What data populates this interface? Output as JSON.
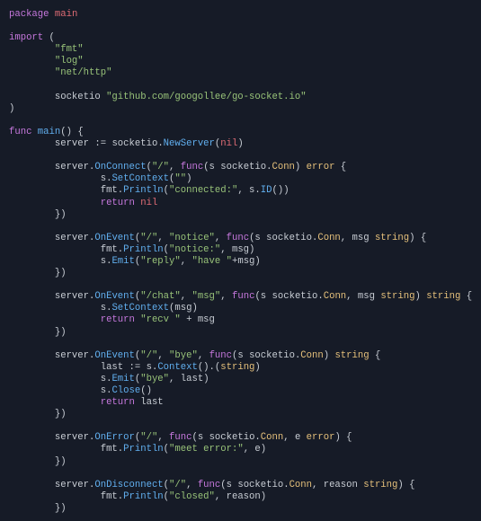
{
  "kw": {
    "package": "package",
    "import": "import",
    "func": "func",
    "return": "return"
  },
  "pkg": {
    "main": "main",
    "nil": "nil"
  },
  "fn": {
    "main": "main",
    "NewServer": "NewServer",
    "OnConnect": "OnConnect",
    "SetContext": "SetContext",
    "Println": "Println",
    "ID": "ID",
    "OnEvent": "OnEvent",
    "Emit": "Emit",
    "Context": "Context",
    "Close": "Close",
    "OnError": "OnError",
    "OnDisconnect": "OnDisconnect"
  },
  "typ": {
    "Conn": "Conn",
    "string": "string",
    "error": "error"
  },
  "id": {
    "server": "server",
    "socketio": "socketio",
    "s": "s",
    "fmt": "fmt",
    "msg": "msg",
    "last": "last",
    "e": "e",
    "reason": "reason"
  },
  "str": {
    "fmt": "\"fmt\"",
    "log": "\"log\"",
    "net_http": "\"net/http\"",
    "import_path": "\"github.com/googollee/go-socket.io\"",
    "slash": "\"/\"",
    "empty": "\"\"",
    "connected": "\"connected:\"",
    "notice": "\"notice\"",
    "notice_col": "\"notice:\"",
    "reply": "\"reply\"",
    "have": "\"have \"",
    "slash_chat": "\"/chat\"",
    "msg": "\"msg\"",
    "recv": "\"recv \"",
    "bye": "\"bye\"",
    "meet_error": "\"meet error:\"",
    "closed": "\"closed\""
  },
  "sym": {
    "lparen": "(",
    "rparen": ")",
    "lbrace": "{",
    "rbrace": "}",
    "rbrace_rparen": "})",
    "assign": " := ",
    "dot": ".",
    "comma": ", ",
    "plus": "+",
    "plus_sp": " + ",
    "dot_lparen": ".(",
    "rparen_sp": ") ",
    "rparen_sp_lbrace": ") {",
    "rparen_rparen": "))",
    "lparen_rparen": "()"
  }
}
